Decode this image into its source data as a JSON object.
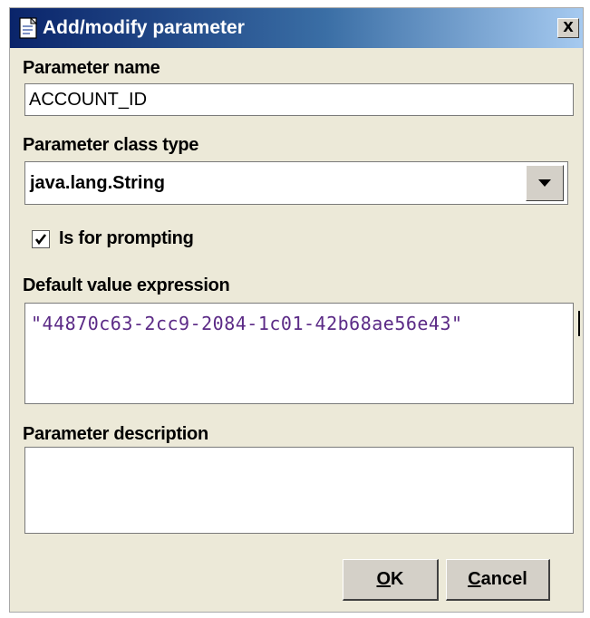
{
  "window": {
    "title": "Add/modify parameter",
    "close_label": "X"
  },
  "parameter_name": {
    "label": "Parameter name",
    "value": "ACCOUNT_ID"
  },
  "class_type": {
    "label": "Parameter class type",
    "selected": "java.lang.String"
  },
  "prompting": {
    "label": "Is for prompting",
    "checked": true
  },
  "default_value": {
    "label": "Default value expression",
    "value": "\"44870c63-2cc9-2084-1c01-42b68ae56e43\""
  },
  "description": {
    "label": "Parameter description",
    "value": ""
  },
  "buttons": {
    "ok_mnemonic": "O",
    "ok_rest": "K",
    "cancel_mnemonic": "C",
    "cancel_rest": "ancel"
  },
  "colors": {
    "title_gradient_start": "#0a246a",
    "dialog_background": "#ece9d8",
    "expression_text": "#5b2a86"
  },
  "icons": {
    "title": "document-icon",
    "close": "close-icon",
    "dropdown": "chevron-down-icon",
    "checkbox": "checkmark-icon"
  }
}
